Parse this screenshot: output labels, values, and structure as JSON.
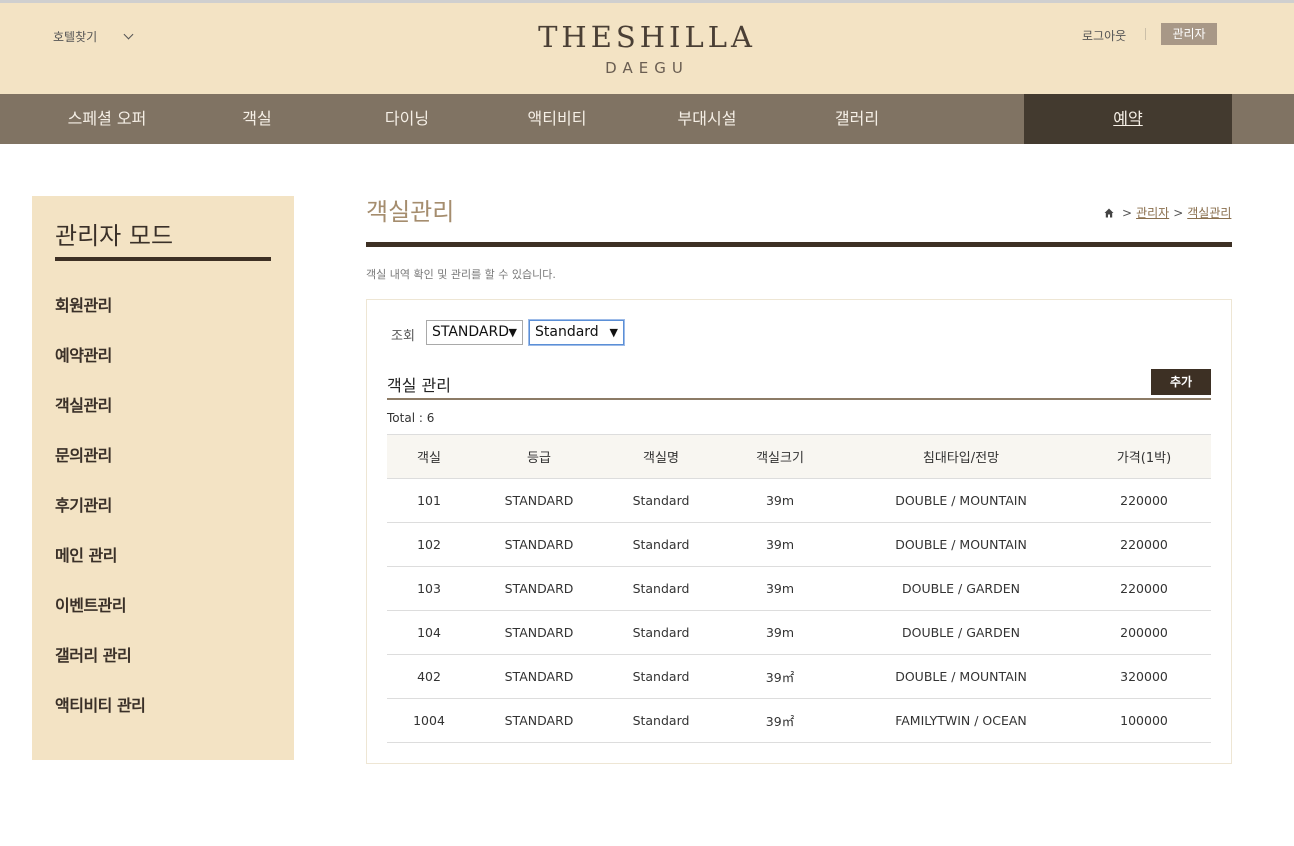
{
  "header": {
    "hotel_find": "호텔찾기",
    "logo_main": "THESHILLA",
    "logo_sub": "DAEGU",
    "logout": "로그아웃",
    "admin": "관리자"
  },
  "nav": {
    "items": [
      "스페셜 오퍼",
      "객실",
      "다이닝",
      "액티비티",
      "부대시설",
      "갤러리"
    ],
    "reserve": "예약"
  },
  "sidebar": {
    "title": "관리자 모드",
    "items": [
      "회원관리",
      "예약관리",
      "객실관리",
      "문의관리",
      "후기관리",
      "메인 관리",
      "이벤트관리",
      "갤러리 관리",
      "액티비티 관리"
    ]
  },
  "main": {
    "title": "객실관리",
    "breadcrumb": {
      "separator": ">",
      "admin": "관리자",
      "current": "객실관리"
    },
    "description": "객실 내역 확인 및 관리를 할 수 있습니다.",
    "search_label": "조회",
    "select_grade": "STANDARD",
    "select_room": "Standard",
    "section_title": "객실 관리",
    "add_button": "추가",
    "total": "Total : 6"
  },
  "table": {
    "columns": [
      "객실",
      "등급",
      "객실명",
      "객실크기",
      "침대타입/전망",
      "가격(1박)"
    ],
    "rows": [
      [
        "101",
        "STANDARD",
        "Standard",
        "39m",
        "DOUBLE / MOUNTAIN",
        "220000"
      ],
      [
        "102",
        "STANDARD",
        "Standard",
        "39m",
        "DOUBLE / MOUNTAIN",
        "220000"
      ],
      [
        "103",
        "STANDARD",
        "Standard",
        "39m",
        "DOUBLE / GARDEN",
        "220000"
      ],
      [
        "104",
        "STANDARD",
        "Standard",
        "39m",
        "DOUBLE / GARDEN",
        "200000"
      ],
      [
        "402",
        "STANDARD",
        "Standard",
        "39㎡",
        "DOUBLE / MOUNTAIN",
        "320000"
      ],
      [
        "1004",
        "STANDARD",
        "Standard",
        "39㎡",
        "FAMILYTWIN / OCEAN",
        "100000"
      ]
    ]
  },
  "colors": {
    "header_bg": "#f3e3c4",
    "nav_bg": "#807363",
    "nav_active_bg": "#433a2f",
    "accent_dark": "#3d3024",
    "title_color": "#a58d6e"
  }
}
